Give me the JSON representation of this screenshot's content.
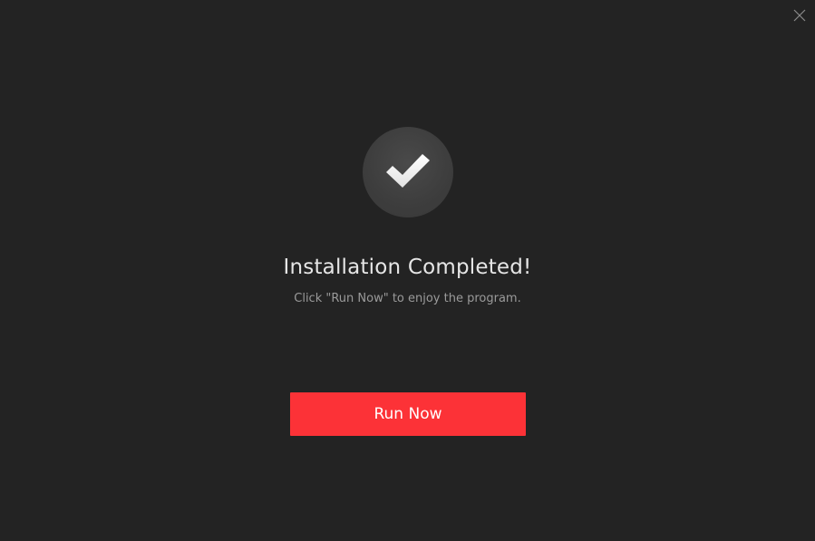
{
  "dialog": {
    "title": "Installation Completed!",
    "subtitle": "Click \"Run Now\" to enjoy the program.",
    "run_button_label": "Run Now",
    "close_icon": "close-icon",
    "status_icon": "checkmark-icon"
  },
  "colors": {
    "background": "#232323",
    "accent": "#fc3237",
    "title_text": "#e6e6e6",
    "subtitle_text": "#9a9a9a",
    "icon_circle": "#3d3d3d"
  }
}
